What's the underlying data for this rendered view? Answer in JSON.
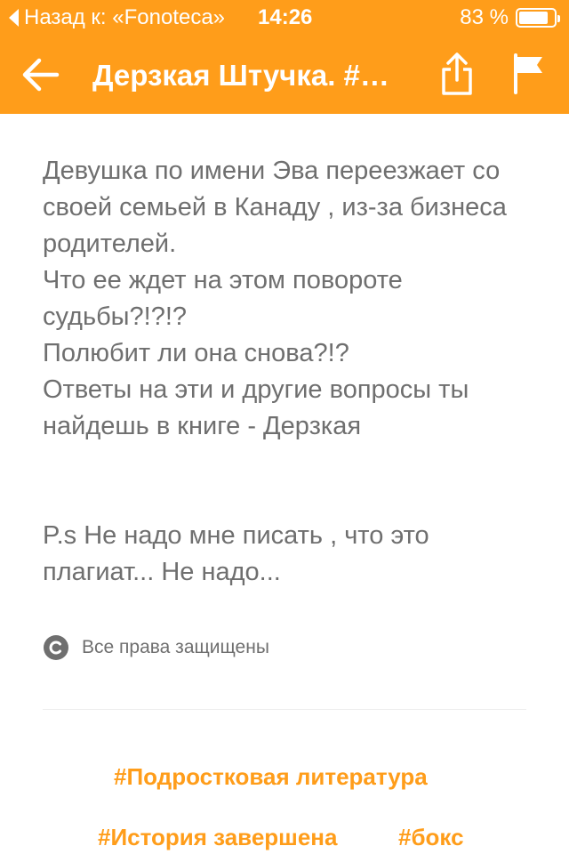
{
  "status_bar": {
    "back_label": "Назад к: «Fonoteca»",
    "time": "14:26",
    "battery_text": "83 %",
    "battery_level": 0.83
  },
  "nav": {
    "title": "Дерзкая Штучка. #…",
    "back_icon": "arrow-left-icon",
    "share_icon": "share-icon",
    "flag_icon": "flag-icon"
  },
  "description": {
    "lines": [
      "Девушка по имени Эва переезжает со своей семьей в Канаду , из-за бизнеса родителей.",
      "Что ее ждет на этом повороте судьбы?!?!?",
      "Полюбит ли она снова?!?",
      "Ответы на эти и другие вопросы ты найдешь в книге - Дерзкая"
    ],
    "ps": "P.s Не надо мне писать , что это плагиат... Не надо..."
  },
  "copyright": {
    "text": "Все права защищены",
    "icon": "copyright-icon"
  },
  "tags": [
    "#Подростковая литература",
    "#История завершена",
    "#бокс"
  ],
  "colors": {
    "accent": "#ff9d1a",
    "text": "#6f6f6f"
  }
}
